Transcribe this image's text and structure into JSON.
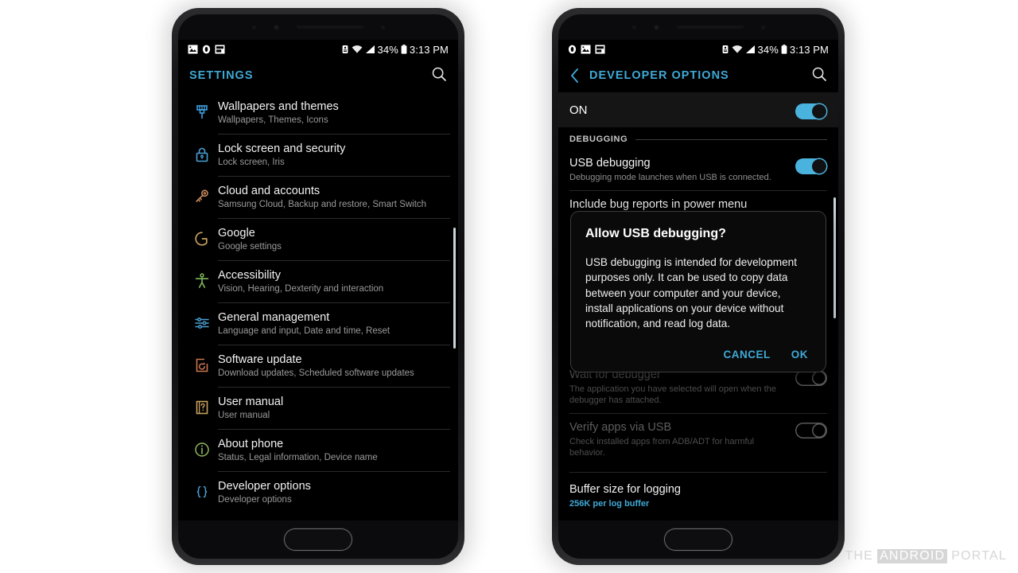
{
  "status_bar": {
    "notification_icons": [
      "image-icon",
      "circle-icon",
      "screenshot-icon"
    ],
    "battery_percent": "34%",
    "time": "3:13 PM",
    "icons_right": [
      "alarm-icon",
      "wifi-icon",
      "signal-icon",
      "battery-icon"
    ]
  },
  "left_phone": {
    "appbar": {
      "title": "SETTINGS",
      "search_icon": "search-icon"
    },
    "items": [
      {
        "title": "Wallpapers and themes",
        "subtitle": "Wallpapers, Themes, Icons",
        "icon": "paint-brush-icon",
        "color": "#3f9ede"
      },
      {
        "title": "Lock screen and security",
        "subtitle": "Lock screen, Iris",
        "icon": "lock-icon",
        "color": "#4a9fd4"
      },
      {
        "title": "Cloud and accounts",
        "subtitle": "Samsung Cloud, Backup and restore, Smart Switch",
        "icon": "key-icon",
        "color": "#c98a5e"
      },
      {
        "title": "Google",
        "subtitle": "Google settings",
        "icon": "google-g-icon",
        "color": "#c9a15e"
      },
      {
        "title": "Accessibility",
        "subtitle": "Vision, Hearing, Dexterity and interaction",
        "icon": "accessibility-icon",
        "color": "#7fb85c"
      },
      {
        "title": "General management",
        "subtitle": "Language and input, Date and time, Reset",
        "icon": "sliders-icon",
        "color": "#4a9fd4"
      },
      {
        "title": "Software update",
        "subtitle": "Download updates, Scheduled software updates",
        "icon": "software-update-icon",
        "color": "#c9764e"
      },
      {
        "title": "User manual",
        "subtitle": "User manual",
        "icon": "question-box-icon",
        "color": "#c9a15e"
      },
      {
        "title": "About phone",
        "subtitle": "Status, Legal information, Device name",
        "icon": "info-icon",
        "color": "#8fb85c"
      },
      {
        "title": "Developer options",
        "subtitle": "Developer options",
        "icon": "braces-icon",
        "color": "#4a9fd4"
      }
    ]
  },
  "right_phone": {
    "appbar": {
      "back_icon": "back-chevron-icon",
      "title": "DEVELOPER OPTIONS",
      "search_icon": "search-icon"
    },
    "master_switch": {
      "label": "ON",
      "state": "on"
    },
    "section_debugging": "DEBUGGING",
    "items": [
      {
        "title": "USB debugging",
        "subtitle": "Debugging mode launches when USB is connected.",
        "toggle": "on",
        "dim": false
      },
      {
        "title": "Include bug reports in power menu",
        "subtitle": "",
        "toggle": "none",
        "dim": false
      },
      {
        "title": "Wait for debugger",
        "subtitle": "The application you have selected will open when the debugger has attached.",
        "toggle": "off",
        "dim": true
      },
      {
        "title": "Verify apps via USB",
        "subtitle": "Check installed apps from ADB/ADT for harmful behavior.",
        "toggle": "off",
        "dim": true
      },
      {
        "title": "Buffer size for logging",
        "subtitle": "256K per log buffer",
        "toggle": "none",
        "dim": false
      }
    ],
    "dialog": {
      "title": "Allow USB debugging?",
      "body": "USB debugging is intended for development purposes only. It can be used to copy data between your computer and your device, install applications on your device without notification, and read log data.",
      "cancel_label": "CANCEL",
      "ok_label": "OK",
      "accent": "#3fa9d6"
    }
  },
  "watermark": {
    "pre": "THE",
    "highlight": "ANDROID",
    "post": "PORTAL"
  }
}
